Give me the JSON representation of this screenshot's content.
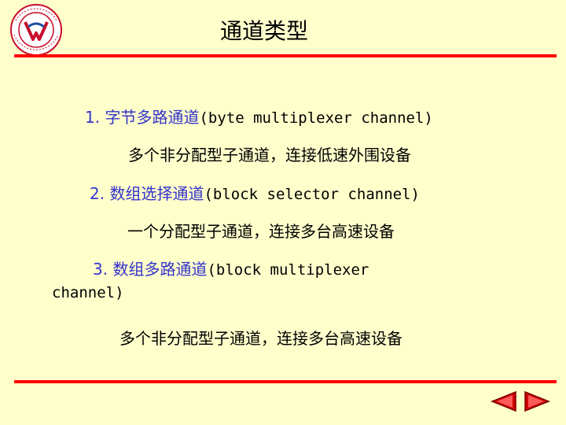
{
  "title": "通道类型",
  "items": [
    {
      "number": "1.",
      "name": "字节多路通道",
      "english": "(byte multiplexer channel)",
      "english_wrap": "",
      "description": "多个非分配型子通道，连接低速外围设备"
    },
    {
      "number": "2.",
      "name": "数组选择通道",
      "english": "(block selector channel)",
      "english_wrap": "",
      "description": "一个分配型子通道，连接多台高速设备"
    },
    {
      "number": "3.",
      "name": "数组多路通道",
      "english": "(block multiplexer",
      "english_wrap": "channel)",
      "description": "多个非分配型子通道，连接多台高速设备"
    }
  ],
  "colors": {
    "background": "#FFFFCC",
    "accent_red": "#FF0000",
    "heading_blue": "#3333CC"
  },
  "nav": {
    "prev_icon": "arrow-left-icon",
    "next_icon": "arrow-right-icon"
  }
}
